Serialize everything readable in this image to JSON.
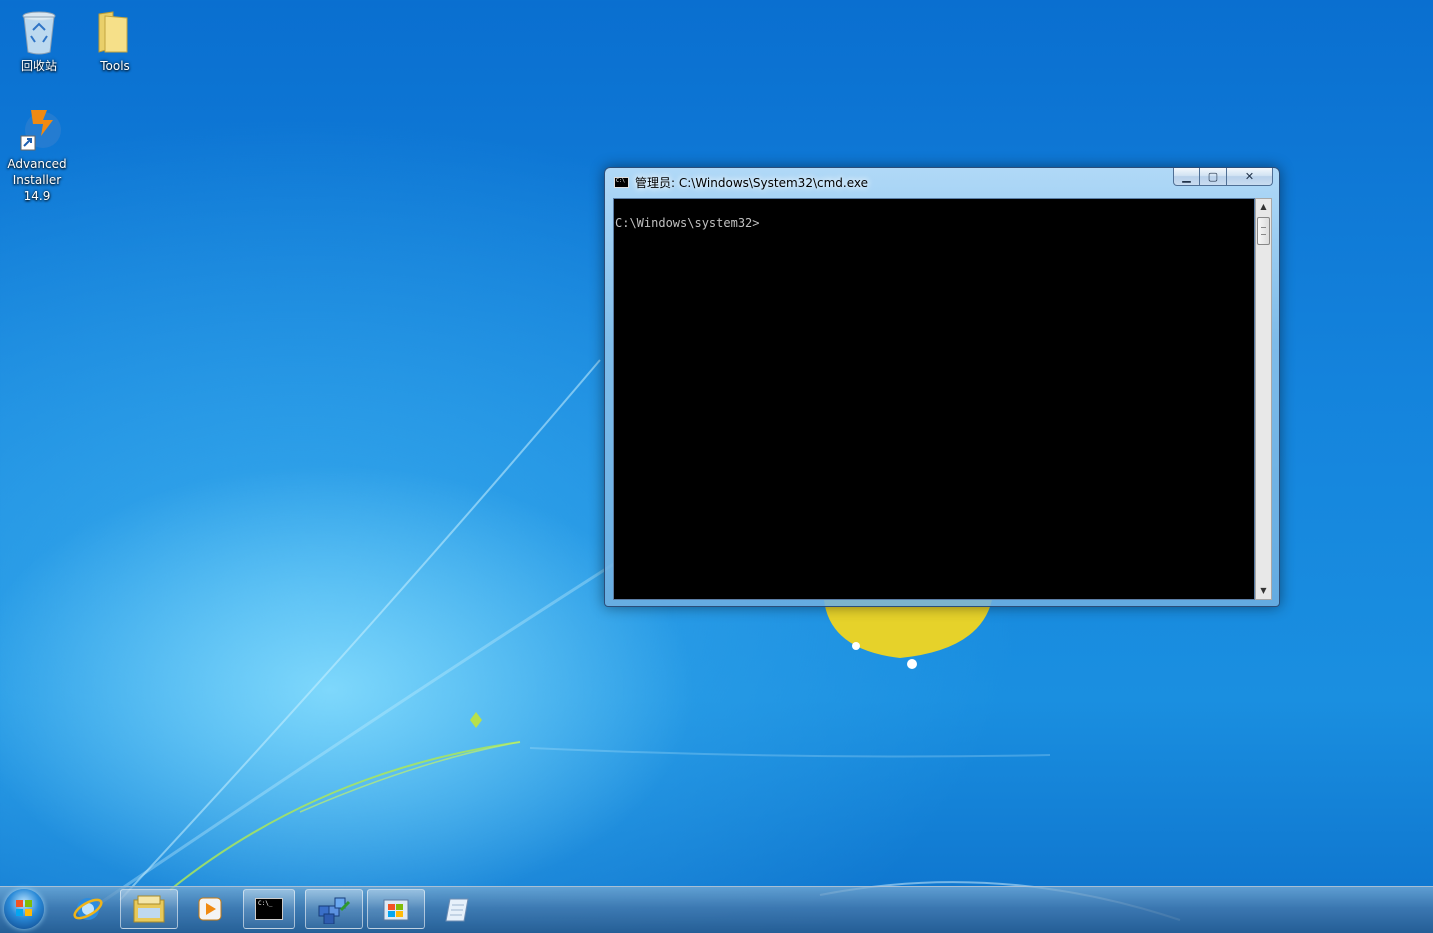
{
  "desktop": {
    "icons": [
      {
        "label": "回收站",
        "icon": "recycle-bin-icon"
      },
      {
        "label": "Tools",
        "icon": "folder-icon"
      },
      {
        "label_line1": "Advanced",
        "label_line2": "Installer 14.9",
        "icon": "advanced-installer-icon"
      }
    ]
  },
  "window": {
    "title": "管理员: C:\\Windows\\System32\\cmd.exe",
    "minimize_icon": "minimize-icon",
    "maximize_icon": "maximize-icon",
    "close_label": "✕",
    "minimize_label": "▁",
    "maximize_label": "▢",
    "console_text": "C:\\Windows\\system32>",
    "scroll_up": "▲",
    "scroll_down": "▼"
  },
  "taskbar": {
    "items": [
      {
        "icon": "start-orb-icon",
        "active": false
      },
      {
        "icon": "internet-explorer-icon",
        "active": false
      },
      {
        "icon": "windows-explorer-icon",
        "active": true
      },
      {
        "icon": "media-player-icon",
        "active": false
      },
      {
        "icon": "command-prompt-icon",
        "active": true
      },
      {
        "icon": "setup-package-icon",
        "active": true
      },
      {
        "icon": "installer-wizard-icon",
        "active": true
      },
      {
        "icon": "notepad-icon",
        "active": false
      }
    ]
  },
  "colors": {
    "desktop_blue": "#1585dd",
    "console_bg": "#000000",
    "console_fg": "#c0c0c0"
  }
}
